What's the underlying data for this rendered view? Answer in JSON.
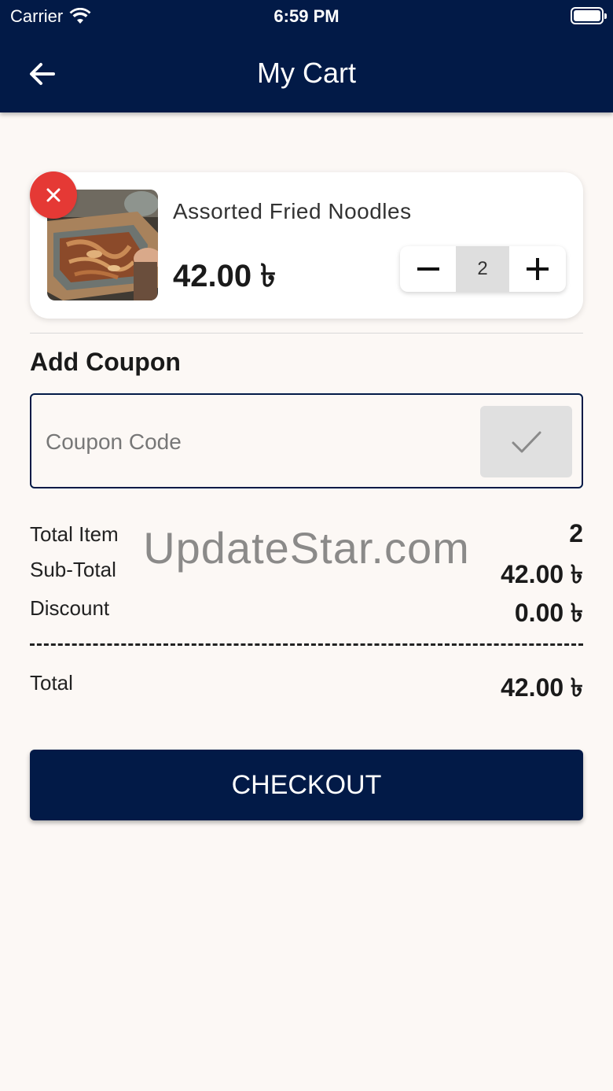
{
  "status_bar": {
    "carrier": "Carrier",
    "time": "6:59 PM"
  },
  "header": {
    "title": "My Cart"
  },
  "cart": {
    "items": [
      {
        "name": "Assorted Fried Noodles",
        "price": "42.00 ৳",
        "quantity": "2"
      }
    ]
  },
  "coupon": {
    "heading": "Add Coupon",
    "placeholder": "Coupon Code",
    "value": ""
  },
  "summary": {
    "total_item_label": "Total Item",
    "total_item_value": "2",
    "subtotal_label": "Sub-Total",
    "subtotal_value": "42.00 ৳",
    "discount_label": "Discount",
    "discount_value": "0.00 ৳",
    "total_label": "Total",
    "total_value": "42.00 ৳"
  },
  "watermark": "UpdateStar.com",
  "checkout": {
    "label": "CHECKOUT"
  },
  "colors": {
    "primary": "#021a47",
    "remove": "#e53935",
    "background": "#fcf8f5"
  },
  "icons": [
    "wifi-icon",
    "battery-icon",
    "back-arrow-icon",
    "close-icon",
    "minus-icon",
    "plus-icon",
    "check-icon"
  ]
}
